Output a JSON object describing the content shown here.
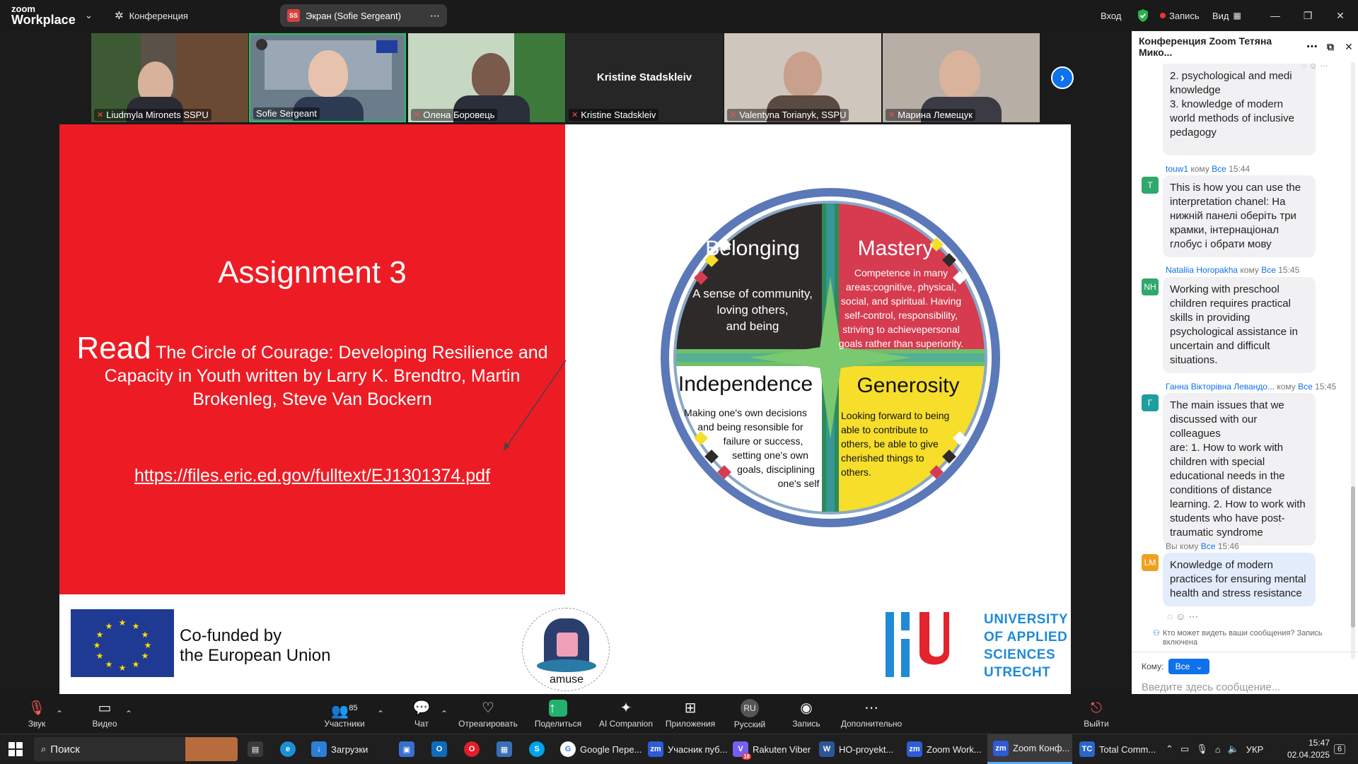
{
  "app": {
    "logo_line1": "zoom",
    "logo_line2": "Workplace",
    "meeting_menu": "Конференция",
    "share_label": "Экран (Sofie Sergeant)",
    "share_initials": "SS",
    "signin": "Вход",
    "recording": "Запись",
    "view": "Вид"
  },
  "participants": [
    {
      "name": "Liudmyla Mironets SSPU",
      "muted": true
    },
    {
      "name": "Sofie Sergeant",
      "muted": false
    },
    {
      "name": "Олена Боровець",
      "muted": true
    },
    {
      "name": "Kristine Stadskleiv",
      "muted": true,
      "center_name": "Kristine Stadskleiv"
    },
    {
      "name": "Valentyna Torianyk, SSPU",
      "muted": true
    },
    {
      "name": "Марина Лемещук",
      "muted": true
    }
  ],
  "slide": {
    "title": "Assignment 3",
    "read_word": "Read",
    "read_text": "The Circle of Courage: Developing Resilience and Capacity in Youth written by Larry K. Brendtro, Martin Brokenleg, Steve Van Bockern",
    "link": "https://files.eric.ed.gov/fulltext/EJ1301374.pdf",
    "circle": {
      "belonging_title": "Belonging",
      "belonging_text": [
        "A sense of community,",
        "loving others,",
        "and being"
      ],
      "mastery_title": "Mastery",
      "mastery_text": [
        "Competence in many",
        "areas;cognitive, physical,",
        "social, and spiritual. Having",
        "self-control, responsibility,",
        "striving to achievepersonal",
        "goals rather than superiority."
      ],
      "independence_title": "Independence",
      "independence_text": [
        "Making one's own decisions",
        "and being resonsible for",
        "failure or success,",
        "setting one's own",
        "goals, disciplining",
        "one's self"
      ],
      "generosity_title": "Generosity",
      "generosity_text": [
        "Looking forward to being",
        "able to contribute to",
        "others, be able to give",
        "cherished things to",
        "others."
      ]
    },
    "eu_text_1": "Co-funded by",
    "eu_text_2": "the European Union",
    "amuse_label": "amuse",
    "hu_text": [
      "UNIVERSITY",
      "OF APPLIED",
      "SCIENCES",
      "UTRECHT"
    ]
  },
  "chat": {
    "title": "Конференция Zoom Тетяна Мико...",
    "messages": [
      {
        "continuation": [
          "2. psychological and medi",
          "knowledge",
          "3. knowledge of modern",
          "world methods of inclusive",
          "pedagogy"
        ]
      },
      {
        "sender": "touw1",
        "to_word": "кому",
        "to": "Все",
        "time": "15:44",
        "initial": "T",
        "color": "#2ea86b",
        "text": [
          "This is how you can use the",
          "interpretation chanel: На",
          "нижній панелі оберіть три",
          "крамки, інтернаціонал",
          "глобус і обрати мову"
        ]
      },
      {
        "sender": "Nataliia Horopakha",
        "to_word": "кому",
        "to": "Все",
        "time": "15:45",
        "initial": "NH",
        "color": "#2ea86b",
        "text": [
          "Working with preschool",
          "children requires practical",
          "skills in providing",
          "psychological assistance in",
          "uncertain and difficult",
          "situations."
        ]
      },
      {
        "sender": "Ганна Вікторівна Левандо...",
        "to_word": "кому",
        "to": "Все",
        "time": "15:45",
        "initial": "Г",
        "color": "#1f9e9e",
        "text": [
          "The main issues that we",
          "discussed with our colleagues",
          "are: 1. How to work with",
          "children with special",
          "educational needs in the",
          "conditions of distance",
          "learning. 2. How to work with",
          "students who have post-",
          "traumatic syndrome"
        ]
      },
      {
        "sender": "Вы",
        "to_word": "кому",
        "to": "Все",
        "time": "15:46",
        "initial": "LM",
        "color": "#f0a020",
        "text": [
          "Knowledge of modern",
          "practices for ensuring mental",
          "health and stress resistance"
        ]
      }
    ],
    "privacy_note": [
      "Кто может видеть ваши сообщения? Запись",
      "включена"
    ],
    "to_label": "Кому:",
    "to_value": "Все",
    "input_placeholder": "Введите здесь сообщение..."
  },
  "toolbar": {
    "audio": "Звук",
    "video": "Видео",
    "participants": "Участники",
    "participants_count": "85",
    "chat": "Чат",
    "react": "Отреагировать",
    "share": "Поделиться",
    "ai": "AI Companion",
    "apps": "Приложения",
    "language": "Русский",
    "language_badge": "RU",
    "record": "Запись",
    "more": "Дополнительно",
    "leave": "Выйти"
  },
  "taskbar": {
    "search": "Поиск",
    "items": [
      "Загрузки",
      "Google Пере...",
      "Учасник пуб...",
      "Rakuten Viber",
      "HO-proyekt...",
      "Zoom Work...",
      "Zoom Конф...",
      "Total Comm..."
    ],
    "viber_badge": "18",
    "lang": "УКР",
    "time": "15:47",
    "date": "02.04.2025",
    "notif": "6"
  }
}
